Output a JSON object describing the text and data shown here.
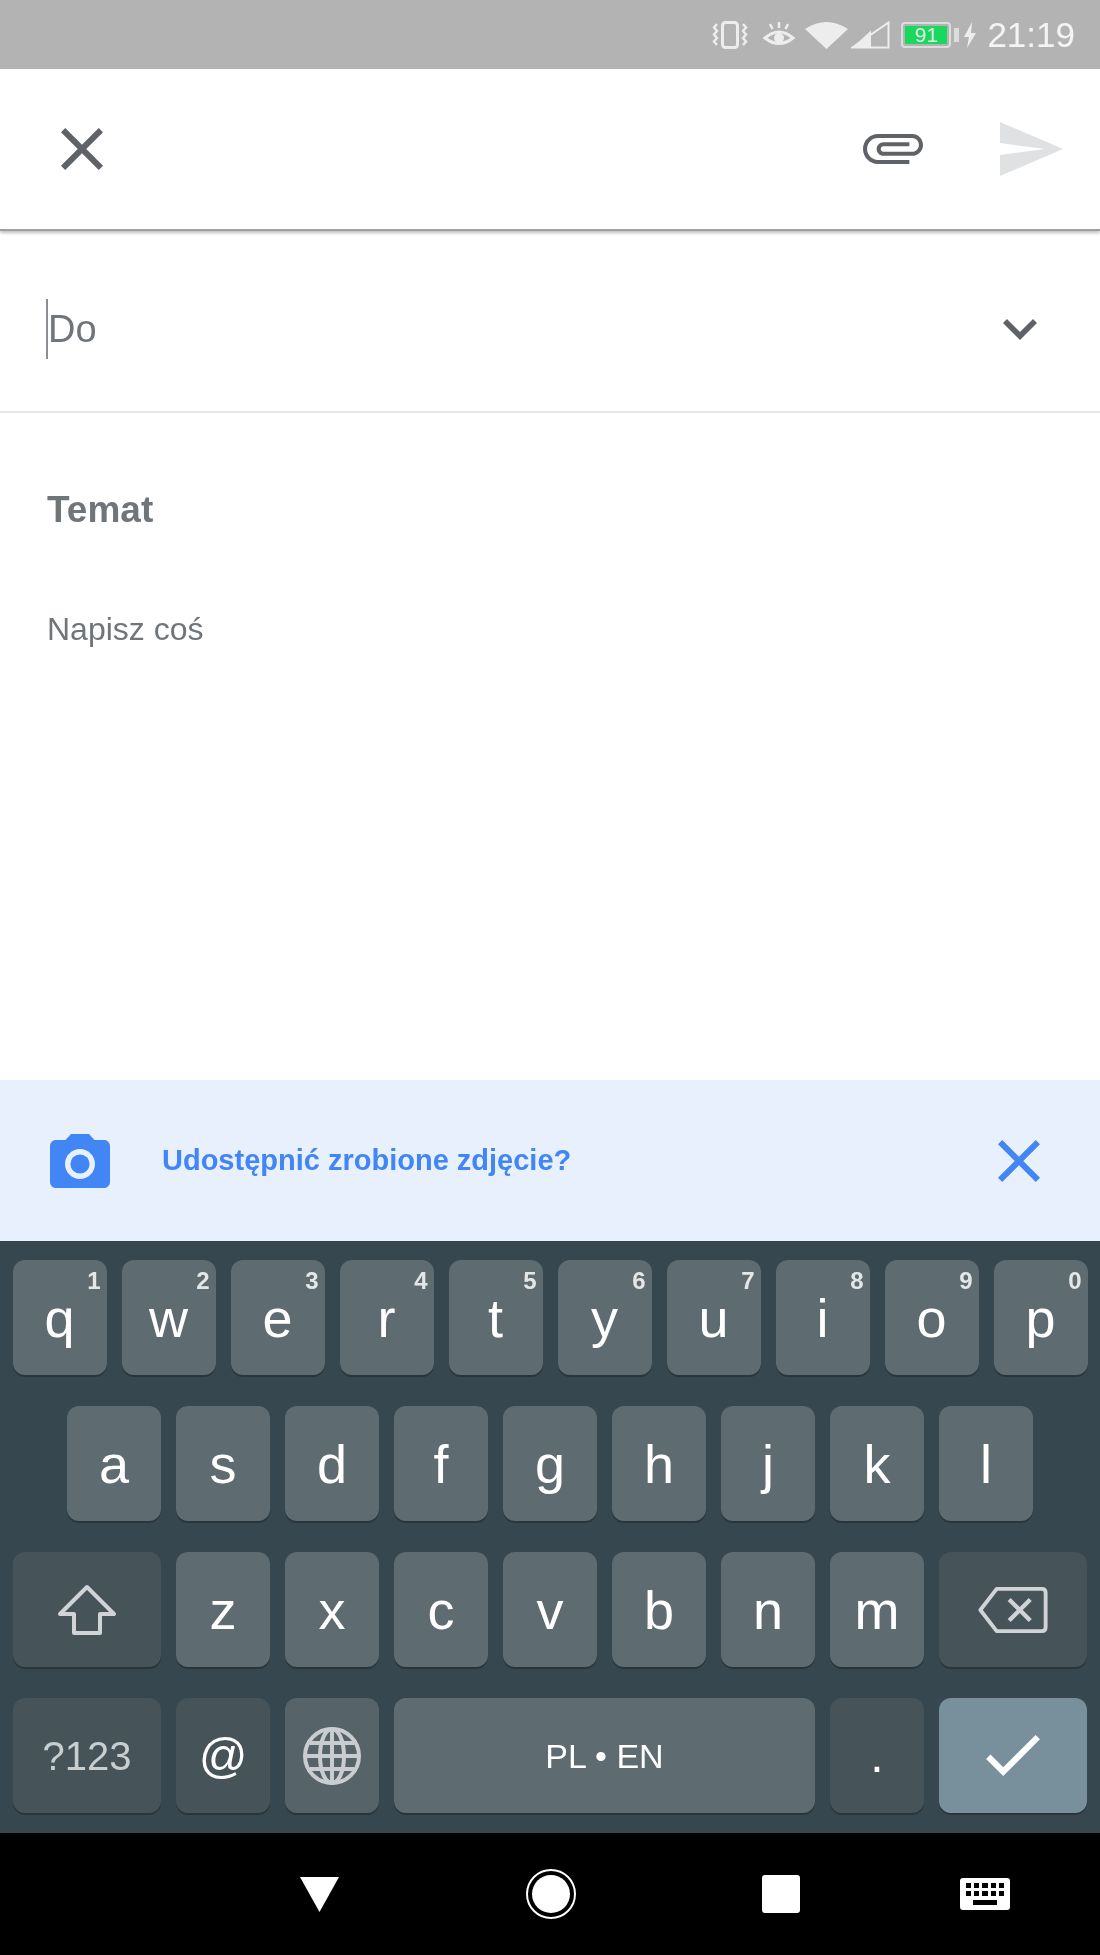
{
  "status_bar": {
    "battery": "91",
    "time": "21:19"
  },
  "toolbar": {
    "send": {
      "disabled": true
    }
  },
  "recipients": {
    "placeholder": "Do",
    "focused": true
  },
  "subject": {
    "placeholder": "Temat"
  },
  "body": {
    "placeholder": "Napisz coś"
  },
  "suggestion": {
    "text": "Udostępnić zrobione zdjęcie?"
  },
  "keyboard": {
    "rows": [
      {
        "keys": [
          {
            "kind": "letter",
            "label": "q",
            "hint": "1"
          },
          {
            "kind": "letter",
            "label": "w",
            "hint": "2"
          },
          {
            "kind": "letter",
            "label": "e",
            "hint": "3"
          },
          {
            "kind": "letter",
            "label": "r",
            "hint": "4"
          },
          {
            "kind": "letter",
            "label": "t",
            "hint": "5"
          },
          {
            "kind": "letter",
            "label": "y",
            "hint": "6"
          },
          {
            "kind": "letter",
            "label": "u",
            "hint": "7"
          },
          {
            "kind": "letter",
            "label": "i",
            "hint": "8"
          },
          {
            "kind": "letter",
            "label": "o",
            "hint": "9"
          },
          {
            "kind": "letter",
            "label": "p",
            "hint": "0"
          }
        ]
      },
      {
        "keys": [
          {
            "kind": "letter",
            "label": "a"
          },
          {
            "kind": "letter",
            "label": "s"
          },
          {
            "kind": "letter",
            "label": "d"
          },
          {
            "kind": "letter",
            "label": "f"
          },
          {
            "kind": "letter",
            "label": "g"
          },
          {
            "kind": "letter",
            "label": "h"
          },
          {
            "kind": "letter",
            "label": "j"
          },
          {
            "kind": "letter",
            "label": "k"
          },
          {
            "kind": "letter",
            "label": "l"
          }
        ]
      },
      {
        "keys": [
          {
            "kind": "shift"
          },
          {
            "kind": "letter",
            "label": "z"
          },
          {
            "kind": "letter",
            "label": "x"
          },
          {
            "kind": "letter",
            "label": "c"
          },
          {
            "kind": "letter",
            "label": "v"
          },
          {
            "kind": "letter",
            "label": "b"
          },
          {
            "kind": "letter",
            "label": "n"
          },
          {
            "kind": "letter",
            "label": "m"
          },
          {
            "kind": "backspace"
          }
        ]
      },
      {
        "keys": [
          {
            "kind": "symbols",
            "label": "?123"
          },
          {
            "kind": "char",
            "label": "@"
          },
          {
            "kind": "globe"
          },
          {
            "kind": "space",
            "label": "PL • EN"
          },
          {
            "kind": "char",
            "label": "."
          },
          {
            "kind": "enter"
          }
        ]
      }
    ]
  }
}
